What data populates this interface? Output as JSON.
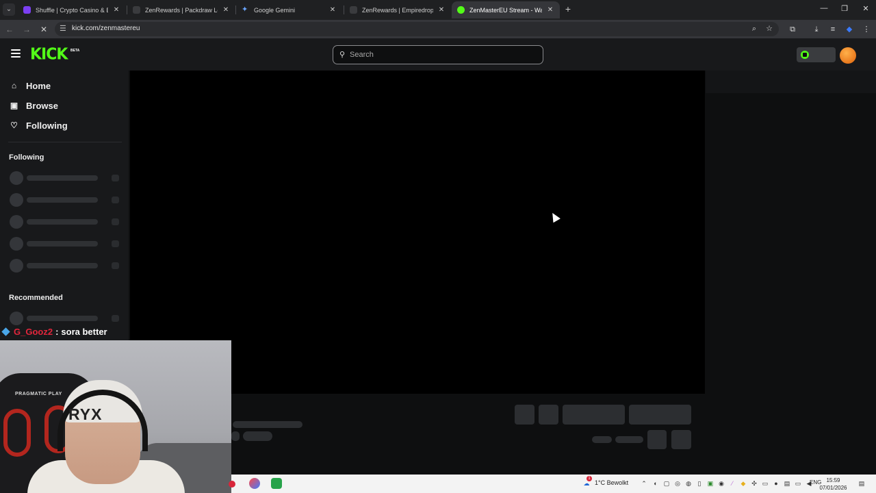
{
  "browser": {
    "tabs": [
      {
        "title": "Shuffle | Crypto Casino & Bitcoin",
        "favicon_color": "#7b3ff2",
        "active": false
      },
      {
        "title": "ZenRewards | Packdraw Leaderboard",
        "favicon_color": "#3a3b3e",
        "active": false
      },
      {
        "title": "Google Gemini",
        "favicon_color": "#6aa5ff",
        "active": false
      },
      {
        "title": "ZenRewards | Empiredrop Leaderboard",
        "favicon_color": "#3a3b3e",
        "active": false
      },
      {
        "title": "ZenMasterEU Stream - Watch Live",
        "favicon_color": "#53fc18",
        "active": true
      }
    ],
    "url": "kick.com/zenmastereu",
    "close_glyph": "✕",
    "newtab_glyph": "+"
  },
  "kick": {
    "logo": "KICK",
    "logo_badge": "BETA",
    "search_placeholder": "Search",
    "nav": [
      {
        "label": "Home",
        "icon": "home-icon"
      },
      {
        "label": "Browse",
        "icon": "browse-icon"
      },
      {
        "label": "Following",
        "icon": "heart-icon"
      }
    ],
    "sections": {
      "following": "Following",
      "recommended": "Recommended"
    },
    "accent": "#53fc18"
  },
  "chat_overlay": {
    "username": "G_Gooz2",
    "separator": ":",
    "message": "sora better"
  },
  "webcam": {
    "beanie_text": "RYX",
    "chair_text": "PRAGMATIC PLAY"
  },
  "taskbar": {
    "weather": "1°C Bewolkt",
    "language": "ENG",
    "time": "15:59",
    "date": "07/01/2026",
    "notification_count": "1"
  }
}
